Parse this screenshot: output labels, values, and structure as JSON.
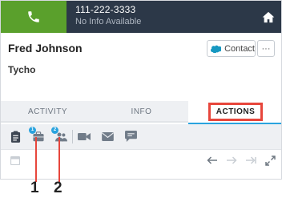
{
  "header": {
    "phone_number": "111-222-3333",
    "phone_subtitle": "No Info Available",
    "call_icon": "phone-icon",
    "home_icon": "home-icon",
    "call_color": "#5aa02c",
    "bar_color": "#2c3848"
  },
  "contact": {
    "name": "Fred Johnson",
    "company": "Tycho",
    "contact_button_label": "Contact",
    "contact_button_icon": "salesforce-cloud-icon",
    "more_label": "···"
  },
  "tabs": [
    {
      "label": "ACTIVITY",
      "active": false
    },
    {
      "label": "INFO",
      "active": false
    },
    {
      "label": "ACTIONS",
      "active": true
    }
  ],
  "actions": {
    "items": [
      {
        "icon": "clipboard-icon"
      },
      {
        "icon": "briefcase-icon",
        "badge": "1"
      },
      {
        "icon": "people-icon",
        "badge": "2"
      },
      {
        "icon": "video-icon"
      },
      {
        "icon": "mail-icon"
      },
      {
        "icon": "chat-icon"
      }
    ]
  },
  "annotations": {
    "first": "1",
    "second": "2",
    "color": "#e7463c"
  }
}
